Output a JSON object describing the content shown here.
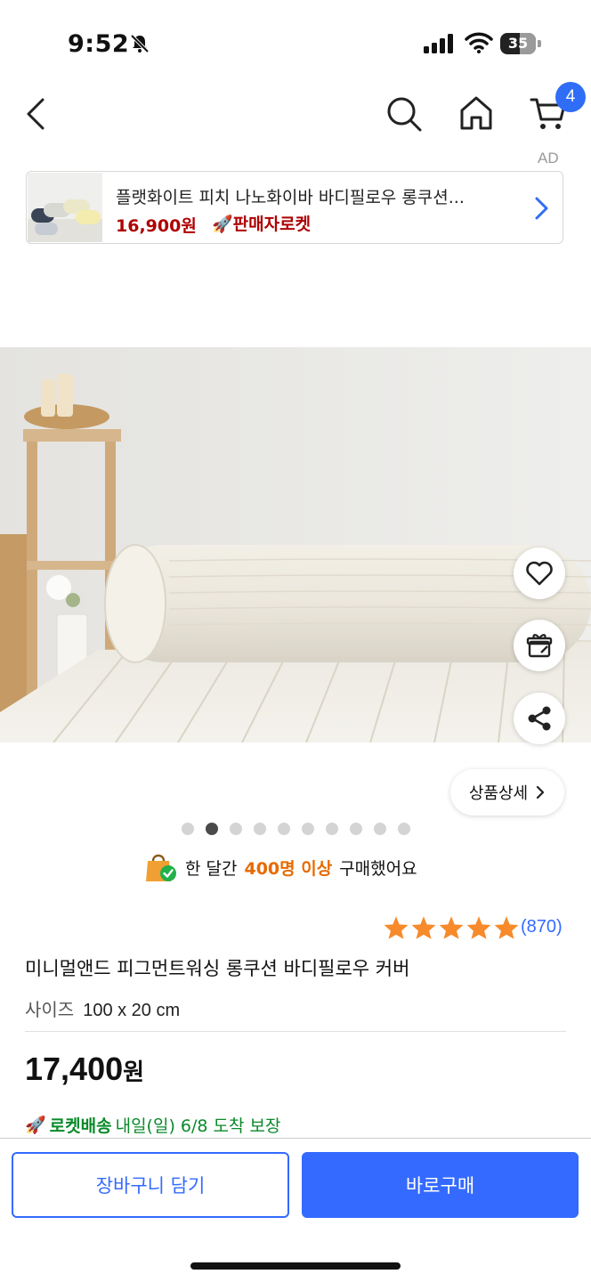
{
  "status_bar": {
    "time": "9:52",
    "battery": "35"
  },
  "nav": {
    "cart_badge": "4",
    "ad_label": "AD"
  },
  "ad": {
    "title": "플랫화이트 피치 나노화이바 바디필로우 롱쿠션...",
    "price": "16,900원",
    "tag": "판매자로켓"
  },
  "gallery": {
    "detail_button": "상품상세",
    "dot_count": 10,
    "active_dot": 2
  },
  "social_proof": {
    "prefix": "한 달간",
    "highlight": "400명 이상",
    "suffix": "구매했어요"
  },
  "product": {
    "rating_stars": 5,
    "review_count": "(870)",
    "name": "미니멀앤드 피그먼트워싱 롱쿠션 바디필로우 커버",
    "size_label": "사이즈",
    "size_value": "100 x 20 cm",
    "price": "17,400",
    "price_unit": "원"
  },
  "delivery": {
    "badge": "로켓배송",
    "text": "내일(일) 6/8 도착 보장"
  },
  "actions": {
    "cart_button": "장바구니 담기",
    "buy_button": "바로구매"
  },
  "colors": {
    "accent": "#346aff",
    "ad_price": "#ae0000",
    "highlight": "#e76a00",
    "rocket_green": "#0a8a2a",
    "star": "#f78a2b"
  }
}
